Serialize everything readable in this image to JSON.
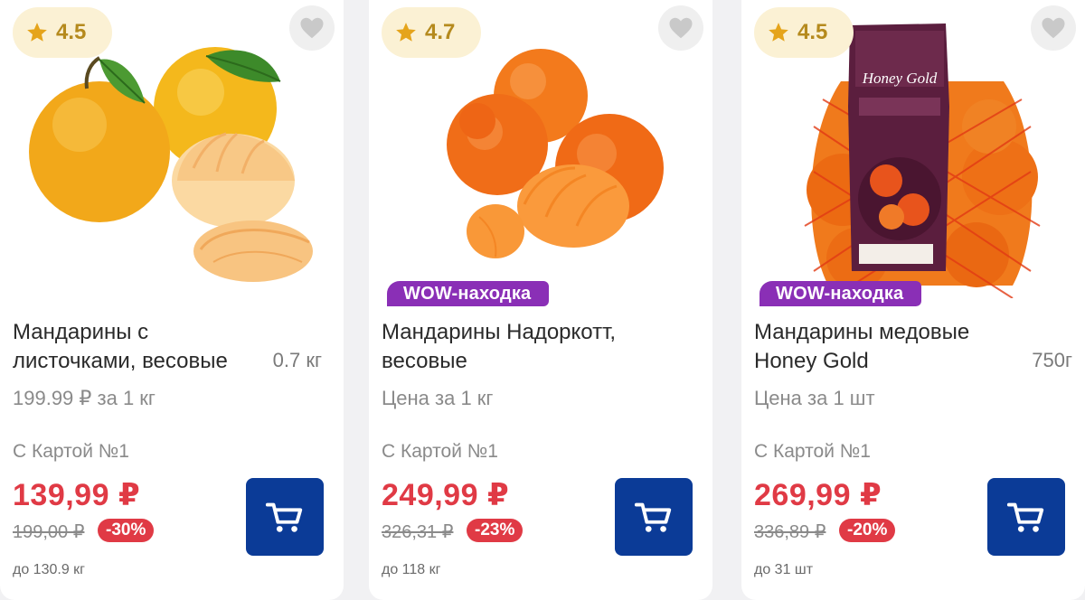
{
  "products": [
    {
      "rating": "4.5",
      "badge": "",
      "title_line1": "Мандарины с",
      "title_line2": "листочками, весовые",
      "weight": "0.7 кг",
      "price_per": "199.99 ₽ за 1 кг",
      "card_label": "С Картой №1",
      "price": "139,99 ₽",
      "old_price": "199,00 ₽",
      "discount": "-30%",
      "limit": "до 130.9 кг"
    },
    {
      "rating": "4.7",
      "badge": "WOW-находка",
      "title_line1": "Мандарины Надоркотт,",
      "title_line2": "весовые",
      "weight": "",
      "price_per": "Цена за 1 кг",
      "card_label": "С Картой №1",
      "price": "249,99 ₽",
      "old_price": "326,31 ₽",
      "discount": "-23%",
      "limit": "до 118 кг"
    },
    {
      "rating": "4.5",
      "badge": "WOW-находка",
      "title_line1": "Мандарины медовые",
      "title_line2": "Honey Gold",
      "weight": "750г",
      "price_per": "Цена за 1 шт",
      "card_label": "С Картой №1",
      "price": "269,99 ₽",
      "old_price": "336,89 ₽",
      "discount": "-20%",
      "limit": "до 31 шт"
    }
  ],
  "package_brand": "Honey Gold",
  "icons": {
    "rating": "star-icon",
    "favorite": "heart-icon",
    "cart": "cart-icon"
  },
  "colors": {
    "price": "#e03a45",
    "badge": "#8a2fb6",
    "cart_button": "#0b3b97",
    "rating_bg": "#fbf1d4"
  }
}
